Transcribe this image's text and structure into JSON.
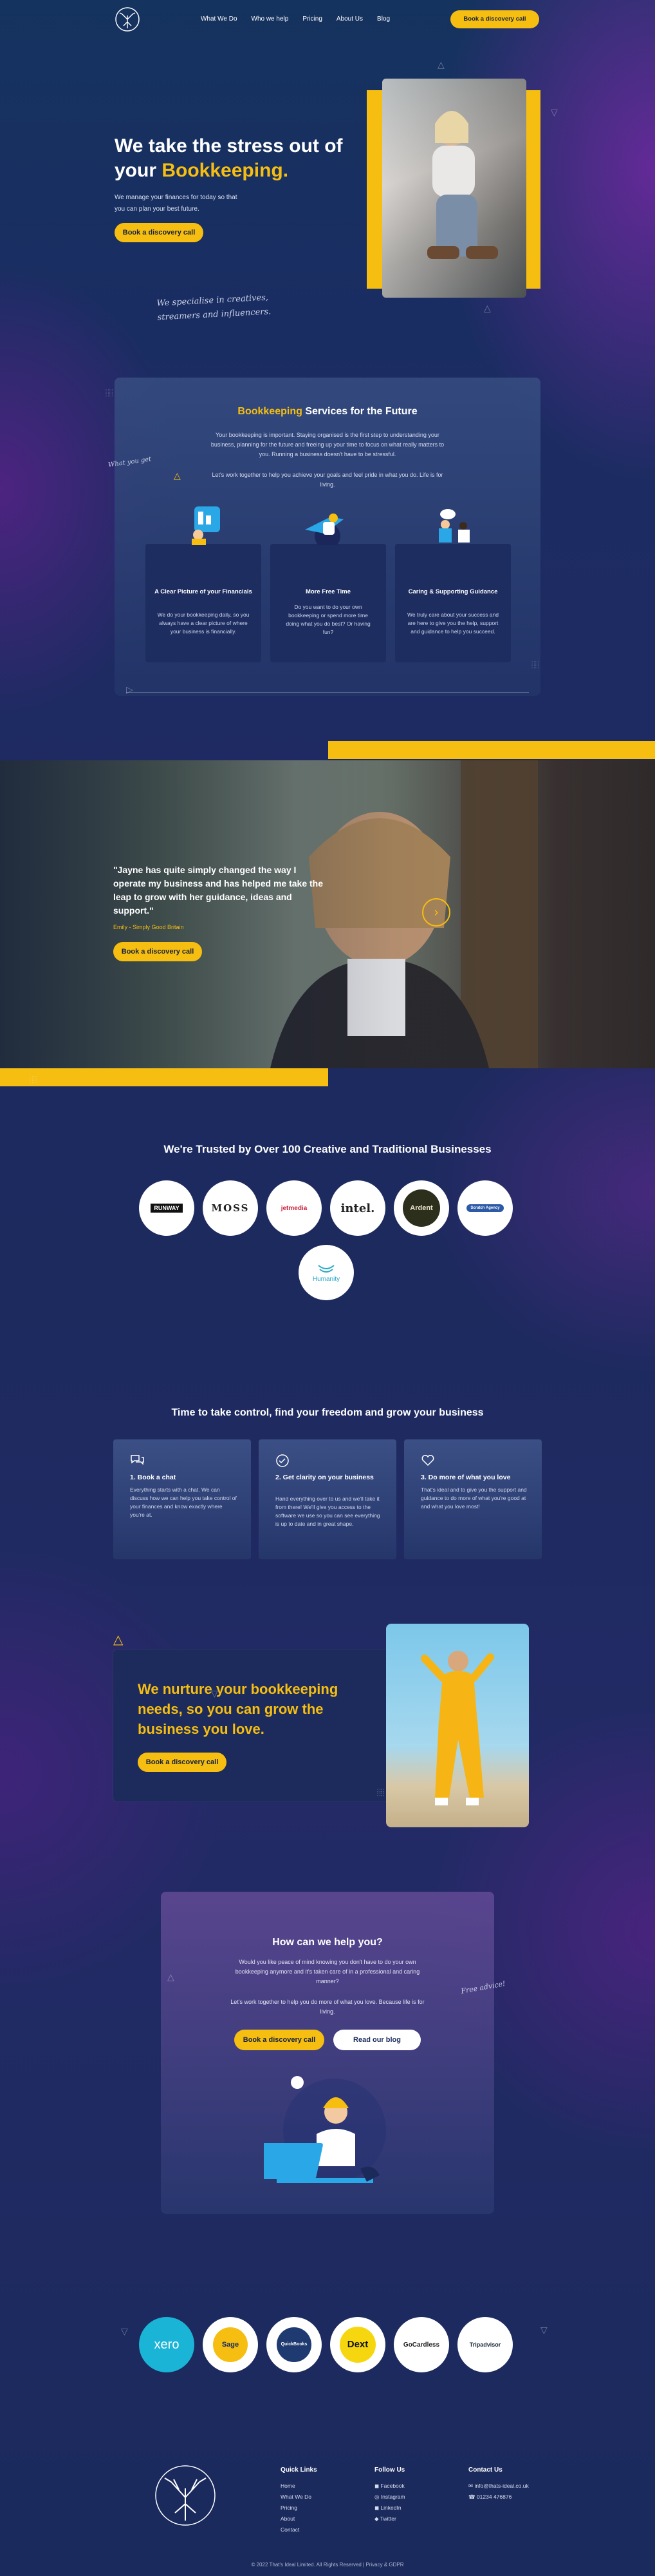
{
  "nav": {
    "links": [
      "What We Do",
      "Who we help",
      "Pricing",
      "About Us",
      "Blog"
    ],
    "cta": "Book a discovery call"
  },
  "hero": {
    "title_line1": "We take the stress out of",
    "title_your": "your ",
    "title_highlight": "Bookkeeping.",
    "sub1": "We manage your finances for today so that",
    "sub2": "you can plan your best future.",
    "cta": "Book a discovery call",
    "script1": "We specialise in creatives,",
    "script2": "streamers and influencers."
  },
  "services": {
    "title_highlight": "Bookkeeping",
    "title_rest": " Services for the Future",
    "p1": "Your bookkeeping is important. Staying organised is the first step to understanding your business, planning for the future and freeing up your time to focus on what really matters to you. Running a business doesn't have to be stressful.",
    "p2": "Let's work together to help you achieve your goals and feel pride in what you do. Life is for living.",
    "side_note": "What you get",
    "cards": [
      {
        "title": "A Clear Picture of your Financials",
        "text": "We do your bookkeeping daily, so you always have a clear picture of where your business is financially."
      },
      {
        "title": "More Free Time",
        "text": "Do you want to do your own bookkeeping or spend more time doing what you do best? Or having fun?"
      },
      {
        "title": "Caring & Supporting Guidance",
        "text": "We truly care about your success and are here to give you the help, support and guidance to help you succeed."
      }
    ]
  },
  "testimonial": {
    "quote": "\"Jayne has quite simply changed the way I operate my business and has helped me take the leap to grow with her guidance, ideas and support.\"",
    "author": "Emily - Simply Good Britain",
    "cta": "Book a discovery call"
  },
  "trusted": {
    "title": "We're Trusted by Over 100 Creative and Traditional Businesses",
    "logos": [
      "RUNWAY",
      "MOSS",
      "jetmedia",
      "intel.",
      "Ardent",
      "Scratch Agency",
      "Humanity"
    ]
  },
  "steps": {
    "title": "Time to take control, find your freedom and grow your business",
    "items": [
      {
        "icon": "chat-icon",
        "title": "1. Book a chat",
        "text": "Everything starts with a chat. We can discuss how we can help you take control of your finances and know exactly where you're at."
      },
      {
        "icon": "check-circle-icon",
        "title": "2. Get clarity on your business",
        "text": "Hand everything over to us and we'll take it from there! We'll give you access to the software we use so you can see everything is up to date and in great shape."
      },
      {
        "icon": "heart-icon",
        "title": "3. Do more of what you love",
        "text": "That's ideal and to give you the support and guidance to do more of what you're good at and what you love most!"
      }
    ]
  },
  "nurture": {
    "title": "We nurture your bookkeeping needs, so you can grow the business you love.",
    "cta": "Book a discovery call"
  },
  "help": {
    "title": "How can we help you?",
    "p1": "Would you like peace of mind knowing you don't have to do your own bookkeeping anymore and it's taken care of in a professional and caring manner?",
    "p2": "Let's work together to help you do more of what you love. Because life is for living.",
    "cta1": "Book a discovery call",
    "cta2": "Read our blog",
    "side_note": "Free advice!"
  },
  "partners": [
    "xero",
    "Sage",
    "QuickBooks",
    "Dext",
    "GoCardless",
    "Tripadvisor"
  ],
  "footer": {
    "quick_title": "Quick Links",
    "quick": [
      "Home",
      "What We Do",
      "Pricing",
      "About",
      "Contact"
    ],
    "follow_title": "Follow Us",
    "follow": [
      "Facebook",
      "Instagram",
      "LinkedIn",
      "Twitter"
    ],
    "contact_title": "Contact Us",
    "contact": [
      "info@thats-ideal.co.uk",
      "01234 476876"
    ],
    "copyright": "© 2022 That's Ideal Limited. All Rights Reserved | Privacy & GDPR"
  },
  "colors": {
    "accent": "#f6be10",
    "bg": "#1a2d62",
    "card": "#2e4580"
  }
}
